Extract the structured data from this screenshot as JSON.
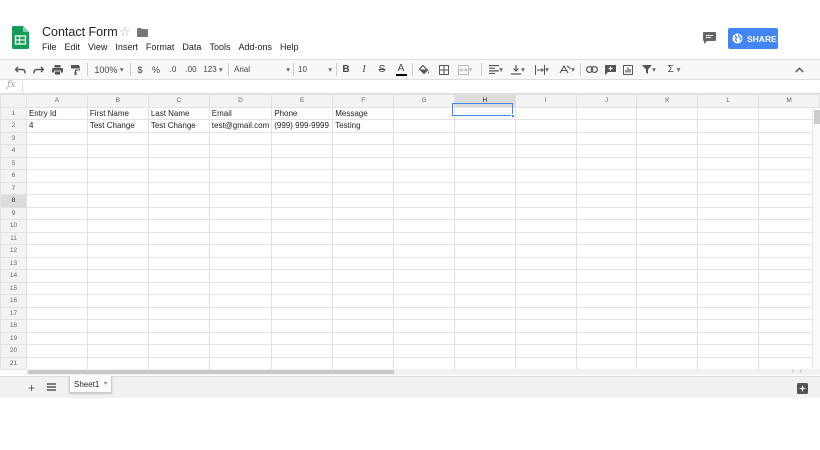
{
  "doc": {
    "title": "Contact Form",
    "star_glyph": "☆",
    "share_label": "SHARE",
    "brand_color": "#0f9d58",
    "accent_color": "#4285f4"
  },
  "menu": [
    "File",
    "Edit",
    "View",
    "Insert",
    "Format",
    "Data",
    "Tools",
    "Add-ons",
    "Help"
  ],
  "toolbar": {
    "zoom": "100%",
    "currency": "$",
    "percent": "%",
    "dec_decrease": ".0",
    "dec_increase": ".00",
    "more_formats": "123",
    "font": "Arial",
    "font_size": "10",
    "bold": "B",
    "italic": "I",
    "strike": "S",
    "text_color": "A",
    "sum": "Σ",
    "drop": "▾",
    "icons": [
      "undo-icon",
      "redo-icon",
      "print-icon",
      "paint-format-icon",
      "fill-color-icon",
      "borders-icon",
      "merge-icon",
      "align-left-icon",
      "valign-bottom-icon",
      "wrap-icon",
      "rotate-icon",
      "link-icon",
      "comment-icon",
      "chart-icon",
      "filter-icon",
      "functions-icon",
      "collapse-icon"
    ]
  },
  "formula_bar": {
    "label": "fx",
    "value": ""
  },
  "grid": {
    "columns": [
      "A",
      "B",
      "C",
      "D",
      "E",
      "F",
      "G",
      "H",
      "I",
      "J",
      "K",
      "L",
      "M"
    ],
    "selected_cell": "H8",
    "rows": [
      [
        "Entry Id",
        "First Name",
        "Last Name",
        "Email",
        "Phone",
        "Message",
        "",
        "",
        "",
        "",
        "",
        "",
        ""
      ],
      [
        "4",
        "Test Change",
        "Test Change",
        "test@gmail.com",
        "(999) 999-9999",
        "Testing",
        "",
        "",
        "",
        "",
        "",
        "",
        ""
      ],
      [
        "",
        "",
        "",
        "",
        "",
        "",
        "",
        "",
        "",
        "",
        "",
        "",
        ""
      ],
      [
        "",
        "",
        "",
        "",
        "",
        "",
        "",
        "",
        "",
        "",
        "",
        "",
        ""
      ],
      [
        "",
        "",
        "",
        "",
        "",
        "",
        "",
        "",
        "",
        "",
        "",
        "",
        ""
      ],
      [
        "",
        "",
        "",
        "",
        "",
        "",
        "",
        "",
        "",
        "",
        "",
        "",
        ""
      ],
      [
        "",
        "",
        "",
        "",
        "",
        "",
        "",
        "",
        "",
        "",
        "",
        "",
        ""
      ],
      [
        "",
        "",
        "",
        "",
        "",
        "",
        "",
        "",
        "",
        "",
        "",
        "",
        ""
      ],
      [
        "",
        "",
        "",
        "",
        "",
        "",
        "",
        "",
        "",
        "",
        "",
        "",
        ""
      ],
      [
        "",
        "",
        "",
        "",
        "",
        "",
        "",
        "",
        "",
        "",
        "",
        "",
        ""
      ],
      [
        "",
        "",
        "",
        "",
        "",
        "",
        "",
        "",
        "",
        "",
        "",
        "",
        ""
      ],
      [
        "",
        "",
        "",
        "",
        "",
        "",
        "",
        "",
        "",
        "",
        "",
        "",
        ""
      ],
      [
        "",
        "",
        "",
        "",
        "",
        "",
        "",
        "",
        "",
        "",
        "",
        "",
        ""
      ],
      [
        "",
        "",
        "",
        "",
        "",
        "",
        "",
        "",
        "",
        "",
        "",
        "",
        ""
      ],
      [
        "",
        "",
        "",
        "",
        "",
        "",
        "",
        "",
        "",
        "",
        "",
        "",
        ""
      ],
      [
        "",
        "",
        "",
        "",
        "",
        "",
        "",
        "",
        "",
        "",
        "",
        "",
        ""
      ],
      [
        "",
        "",
        "",
        "",
        "",
        "",
        "",
        "",
        "",
        "",
        "",
        "",
        ""
      ],
      [
        "",
        "",
        "",
        "",
        "",
        "",
        "",
        "",
        "",
        "",
        "",
        "",
        ""
      ],
      [
        "",
        "",
        "",
        "",
        "",
        "",
        "",
        "",
        "",
        "",
        "",
        "",
        ""
      ],
      [
        "",
        "",
        "",
        "",
        "",
        "",
        "",
        "",
        "",
        "",
        "",
        "",
        ""
      ],
      [
        "",
        "",
        "",
        "",
        "",
        "",
        "",
        "",
        "",
        "",
        "",
        "",
        ""
      ]
    ]
  },
  "sheets": {
    "add_glyph": "+",
    "tabs": [
      "Sheet1"
    ],
    "caret": "▾",
    "scroll_arrows": "‹ ›"
  }
}
